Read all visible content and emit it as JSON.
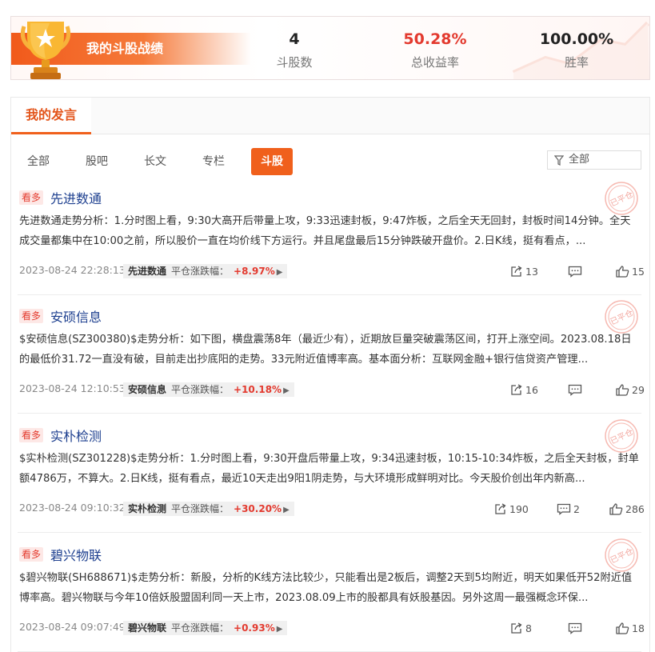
{
  "summary": {
    "title": "我的斗股战绩",
    "stats": [
      {
        "value": "4",
        "label": "斗股数"
      },
      {
        "value": "50.28%",
        "label": "总收益率"
      },
      {
        "value": "100.00%",
        "label": "胜率"
      }
    ]
  },
  "section": {
    "title": "我的发言",
    "tabs": [
      "全部",
      "股吧",
      "长文",
      "专栏",
      "斗股"
    ],
    "active_tab": "斗股",
    "filter": {
      "value": "全部"
    }
  },
  "posts": [
    {
      "badge": "看多",
      "stock": "先进数通",
      "body": "先进数通走势分析：1.分时图上看，9:30大高开后带量上攻，9:33迅速封板，9:47炸板，之后全天无回封，封板时间14分钟。全天成交量都集中在10:00之前，所以股价一直在均价线下方运行。并且尾盘最后15分钟跌破开盘价。2.日K线，挺有看点，...",
      "time": "2023-08-24 22:28:13",
      "tag_stock": "先进数通",
      "tag_label": "平仓涨跌幅：",
      "tag_gain": "+8.97%",
      "shares": "13",
      "comments": "",
      "likes": "15"
    },
    {
      "badge": "看多",
      "stock": "安硕信息",
      "body": "$安硕信息(SZ300380)$走势分析：如下图，横盘震荡8年（最近少有），近期放巨量突破震荡区间，打开上涨空间。2023.08.18日的最低价31.72一直没有破，目前走出抄底阳的走势。33元附近值博率高。基本面分析：互联网金融+银行信贷资产管理...",
      "time": "2023-08-24 12:10:53",
      "tag_stock": "安硕信息",
      "tag_label": "平仓涨跌幅：",
      "tag_gain": "+10.18%",
      "shares": "16",
      "comments": "",
      "likes": "29"
    },
    {
      "badge": "看多",
      "stock": "实朴检测",
      "body": "$实朴检测(SZ301228)$走势分析：1.分时图上看，9:30开盘后带量上攻，9:34迅速封板，10:15-10:34炸板，之后全天封板，封单额4786万，不算大。2.日K线，挺有看点，最近10天走出9阳1阴走势，与大环境形成鲜明对比。今天股价创出年内新高...",
      "time": "2023-08-24 09:10:32",
      "tag_stock": "实朴检测",
      "tag_label": "平仓涨跌幅：",
      "tag_gain": "+30.20%",
      "shares": "190",
      "comments": "2",
      "likes": "286"
    },
    {
      "badge": "看多",
      "stock": "碧兴物联",
      "body": "$碧兴物联(SH688671)$走势分析：新股，分析的K线方法比较少，只能看出是2板后，调整2天到5均附近，明天如果低开52附近值博率高。碧兴物联与今年10倍妖股盟固利同一天上市，2023.08.09上市的股都具有妖股基因。另外这周一最强概念环保...",
      "time": "2023-08-24 09:07:49",
      "tag_stock": "碧兴物联",
      "tag_label": "平仓涨跌幅：",
      "tag_gain": "+0.93%",
      "shares": "8",
      "comments": "",
      "likes": "18"
    }
  ],
  "stamp_text": "已平仓",
  "colors": {
    "accent": "#f0601c",
    "gain": "#e33a2f",
    "link": "#1d3f8f"
  }
}
